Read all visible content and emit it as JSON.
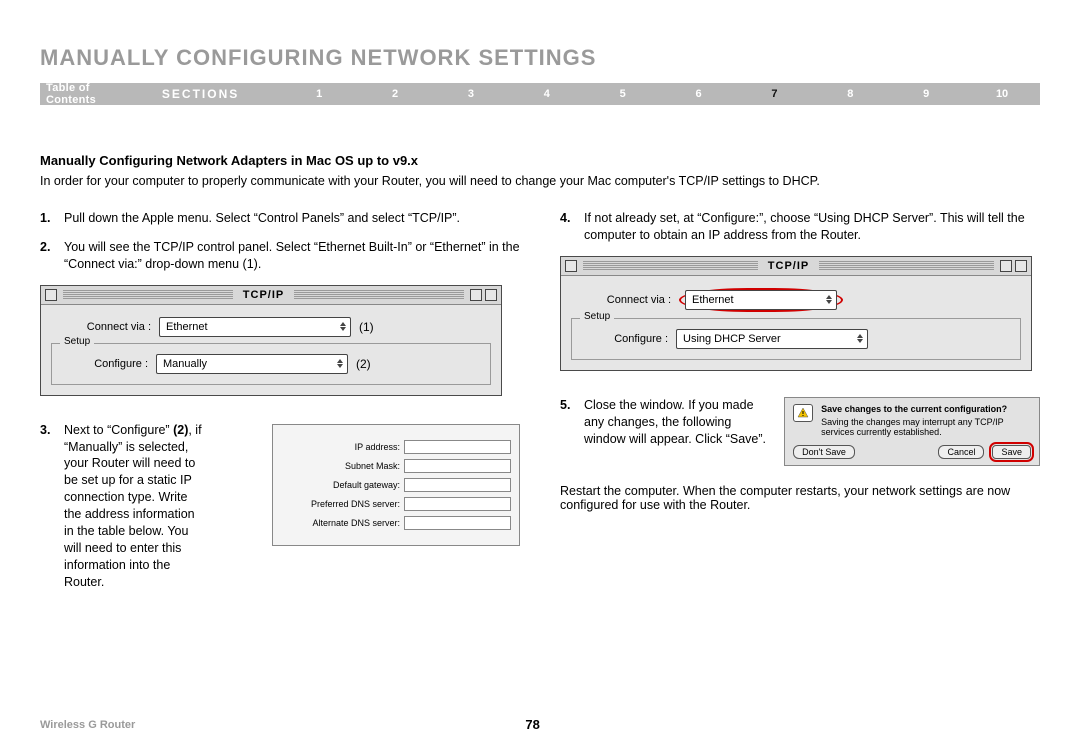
{
  "title": "MANUALLY CONFIGURING NETWORK SETTINGS",
  "nav": {
    "toc": "Table of Contents",
    "sections_label": "SECTIONS",
    "items": [
      "1",
      "2",
      "3",
      "4",
      "5",
      "6",
      "7",
      "8",
      "9",
      "10"
    ],
    "active_index": 6
  },
  "subheading": "Manually Configuring Network Adapters in Mac OS up to v9.x",
  "intro": "In order for your computer to properly communicate with your Router, you will need to change your Mac computer's TCP/IP settings to DHCP.",
  "steps": {
    "s1": {
      "n": "1.",
      "text": "Pull down the Apple menu. Select “Control Panels” and select “TCP/IP”."
    },
    "s2": {
      "n": "2.",
      "text": "You will see the TCP/IP control panel. Select “Ethernet Built-In” or “Ethernet” in the “Connect via:” drop-down menu (1)."
    },
    "s3": {
      "n": "3.",
      "text_a": "Next to “Configure” ",
      "text_b": "(2)",
      "text_c": ", if “Manually” is selected, your Router will need to be set up for a static IP connection type. Write the address information in the table below. You will need to enter this information into the Router."
    },
    "s4": {
      "n": "4.",
      "text": "If not already set, at “Configure:”, choose “Using DHCP Server”. This will tell the computer to obtain an IP address from the Router."
    },
    "s5": {
      "n": "5.",
      "text": "Close the window. If you made any changes, the following window will appear. Click “Save”."
    }
  },
  "restart_text": "Restart the computer. When the computer restarts, your network settings are now configured for use with the Router.",
  "tcpip1": {
    "title": "TCP/IP",
    "connect_via_label": "Connect via :",
    "connect_via_value": "Ethernet",
    "anno1": "(1)",
    "setup_label": "Setup",
    "configure_label": "Configure :",
    "configure_value": "Manually",
    "anno2": "(2)"
  },
  "tcpip2": {
    "title": "TCP/IP",
    "connect_via_label": "Connect via :",
    "connect_via_value": "Ethernet",
    "setup_label": "Setup",
    "configure_label": "Configure :",
    "configure_value": "Using DHCP Server"
  },
  "ipbox": {
    "ip": "IP address:",
    "mask": "Subnet Mask:",
    "gw": "Default gateway:",
    "dns1": "Preferred DNS server:",
    "dns2": "Alternate DNS server:"
  },
  "dialog": {
    "q": "Save changes to the current configuration?",
    "info": "Saving the changes may interrupt any TCP/IP services currently established.",
    "dont_save": "Don't Save",
    "cancel": "Cancel",
    "save": "Save"
  },
  "footer": {
    "product": "Wireless G Router",
    "page": "78"
  }
}
